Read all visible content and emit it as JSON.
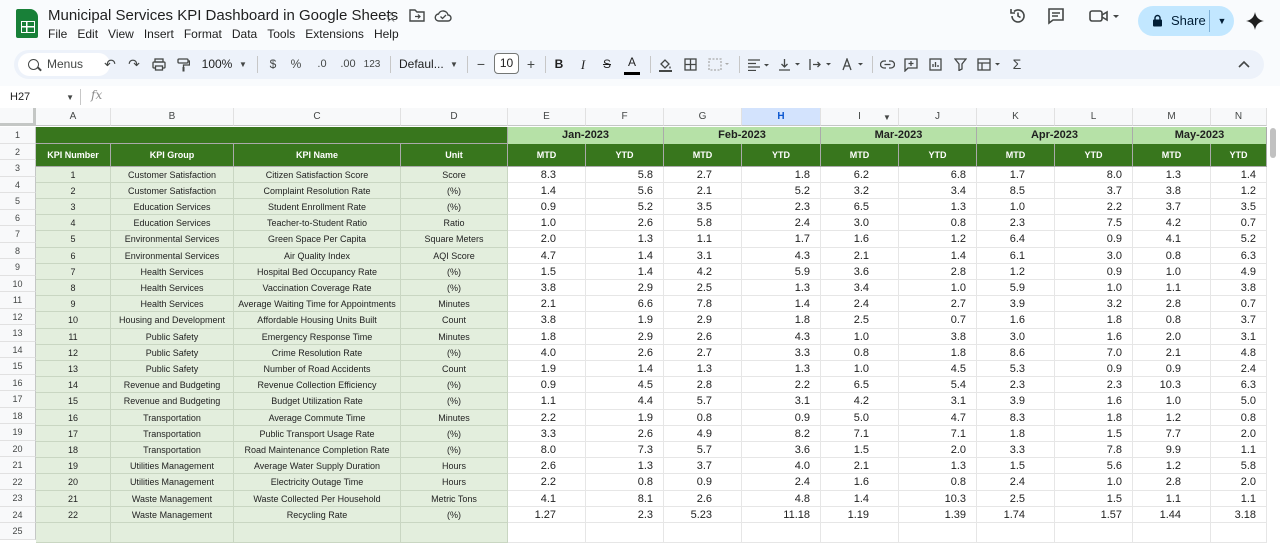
{
  "doc": {
    "title": "Municipal Services KPI Dashboard in Google Sheets"
  },
  "menu": [
    "File",
    "Edit",
    "View",
    "Insert",
    "Format",
    "Data",
    "Tools",
    "Extensions",
    "Help"
  ],
  "share": {
    "label": "Share"
  },
  "toolbar": {
    "menus": "Menus",
    "zoom": "100%",
    "currency": "$",
    "percent": "%",
    "dec_less": ".0",
    "dec_more": ".00",
    "number_fmt": "123",
    "font": "Defaul...",
    "font_size": "10"
  },
  "formula_bar": {
    "cell_ref": "H27",
    "fx": "fx"
  },
  "columns": [
    "A",
    "B",
    "C",
    "D",
    "E",
    "F",
    "G",
    "H",
    "I",
    "J",
    "K",
    "L",
    "M",
    "N"
  ],
  "selected_column": "H",
  "rows": [
    "1",
    "2",
    "3",
    "4",
    "5",
    "6",
    "7",
    "8",
    "9",
    "10",
    "11",
    "12",
    "13",
    "14",
    "15",
    "16",
    "17",
    "18",
    "19",
    "20",
    "21",
    "22",
    "23",
    "24",
    "25"
  ],
  "sheet": {
    "headers": [
      "KPI Number",
      "KPI Group",
      "KPI Name",
      "Unit"
    ],
    "months": [
      "Jan-2023",
      "Feb-2023",
      "Mar-2023",
      "Apr-2023",
      "May-2023"
    ],
    "sub": [
      "MTD",
      "YTD"
    ],
    "kpis": [
      [
        "1",
        "Customer Satisfaction",
        "Citizen Satisfaction Score",
        "Score"
      ],
      [
        "2",
        "Customer Satisfaction",
        "Complaint Resolution Rate",
        "(%)"
      ],
      [
        "3",
        "Education Services",
        "Student Enrollment Rate",
        "(%)"
      ],
      [
        "4",
        "Education Services",
        "Teacher-to-Student Ratio",
        "Ratio"
      ],
      [
        "5",
        "Environmental Services",
        "Green Space Per Capita",
        "Square Meters"
      ],
      [
        "6",
        "Environmental Services",
        "Air Quality Index",
        "AQI Score"
      ],
      [
        "7",
        "Health Services",
        "Hospital Bed Occupancy Rate",
        "(%)"
      ],
      [
        "8",
        "Health Services",
        "Vaccination Coverage Rate",
        "(%)"
      ],
      [
        "9",
        "Health Services",
        "Average Waiting Time for Appointments",
        "Minutes"
      ],
      [
        "10",
        "Housing and Development",
        "Affordable Housing Units Built",
        "Count"
      ],
      [
        "11",
        "Public Safety",
        "Emergency Response Time",
        "Minutes"
      ],
      [
        "12",
        "Public Safety",
        "Crime Resolution Rate",
        "(%)"
      ],
      [
        "13",
        "Public Safety",
        "Number of Road Accidents",
        "Count"
      ],
      [
        "14",
        "Revenue and Budgeting",
        "Revenue Collection Efficiency",
        "(%)"
      ],
      [
        "15",
        "Revenue and Budgeting",
        "Budget Utilization Rate",
        "(%)"
      ],
      [
        "16",
        "Transportation",
        "Average Commute Time",
        "Minutes"
      ],
      [
        "17",
        "Transportation",
        "Public Transport Usage Rate",
        "(%)"
      ],
      [
        "18",
        "Transportation",
        "Road Maintenance Completion Rate",
        "(%)"
      ],
      [
        "19",
        "Utilities Management",
        "Average Water Supply Duration",
        "Hours"
      ],
      [
        "20",
        "Utilities Management",
        "Electricity Outage Time",
        "Hours"
      ],
      [
        "21",
        "Waste Management",
        "Waste Collected Per Household",
        "Metric Tons"
      ],
      [
        "22",
        "Waste Management",
        "Recycling Rate",
        "(%)"
      ]
    ],
    "values": [
      [
        "8.3",
        "5.8",
        "2.7",
        "1.8",
        "6.2",
        "6.8",
        "1.7",
        "8.0",
        "1.3",
        "1.4"
      ],
      [
        "1.4",
        "5.6",
        "2.1",
        "5.2",
        "3.2",
        "3.4",
        "8.5",
        "3.7",
        "3.8",
        "1.2"
      ],
      [
        "0.9",
        "5.2",
        "3.5",
        "2.3",
        "6.5",
        "1.3",
        "1.0",
        "2.2",
        "3.7",
        "3.5"
      ],
      [
        "1.0",
        "2.6",
        "5.8",
        "2.4",
        "3.0",
        "0.8",
        "2.3",
        "7.5",
        "4.2",
        "0.7"
      ],
      [
        "2.0",
        "1.3",
        "1.1",
        "1.7",
        "1.6",
        "1.2",
        "6.4",
        "0.9",
        "4.1",
        "5.2"
      ],
      [
        "4.7",
        "1.4",
        "3.1",
        "4.3",
        "2.1",
        "1.4",
        "6.1",
        "3.0",
        "0.8",
        "6.3"
      ],
      [
        "1.5",
        "1.4",
        "4.2",
        "5.9",
        "3.6",
        "2.8",
        "1.2",
        "0.9",
        "1.0",
        "4.9"
      ],
      [
        "3.8",
        "2.9",
        "2.5",
        "1.3",
        "3.4",
        "1.0",
        "5.9",
        "1.0",
        "1.1",
        "3.8"
      ],
      [
        "2.1",
        "6.6",
        "7.8",
        "1.4",
        "2.4",
        "2.7",
        "3.9",
        "3.2",
        "2.8",
        "0.7"
      ],
      [
        "3.8",
        "1.9",
        "2.9",
        "1.8",
        "2.5",
        "0.7",
        "1.6",
        "1.8",
        "0.8",
        "3.7"
      ],
      [
        "1.8",
        "2.9",
        "2.6",
        "4.3",
        "1.0",
        "3.8",
        "3.0",
        "1.6",
        "2.0",
        "3.1"
      ],
      [
        "4.0",
        "2.6",
        "2.7",
        "3.3",
        "0.8",
        "1.8",
        "8.6",
        "7.0",
        "2.1",
        "4.8"
      ],
      [
        "1.9",
        "1.4",
        "1.3",
        "1.3",
        "1.0",
        "4.5",
        "5.3",
        "0.9",
        "0.9",
        "2.4"
      ],
      [
        "0.9",
        "4.5",
        "2.8",
        "2.2",
        "6.5",
        "5.4",
        "2.3",
        "2.3",
        "10.3",
        "6.3"
      ],
      [
        "1.1",
        "4.4",
        "5.7",
        "3.1",
        "4.2",
        "3.1",
        "3.9",
        "1.6",
        "1.0",
        "5.0"
      ],
      [
        "2.2",
        "1.9",
        "0.8",
        "0.9",
        "5.0",
        "4.7",
        "8.3",
        "1.8",
        "1.2",
        "0.8"
      ],
      [
        "3.3",
        "2.6",
        "4.9",
        "8.2",
        "7.1",
        "7.1",
        "1.8",
        "1.5",
        "7.7",
        "2.0"
      ],
      [
        "8.0",
        "7.3",
        "5.7",
        "3.6",
        "1.5",
        "2.0",
        "3.3",
        "7.8",
        "9.9",
        "1.1"
      ],
      [
        "2.6",
        "1.3",
        "3.7",
        "4.0",
        "2.1",
        "1.3",
        "1.5",
        "5.6",
        "1.2",
        "5.8"
      ],
      [
        "2.2",
        "0.8",
        "0.9",
        "2.4",
        "1.6",
        "0.8",
        "2.4",
        "1.0",
        "2.8",
        "2.0"
      ],
      [
        "4.1",
        "8.1",
        "2.6",
        "4.8",
        "1.4",
        "10.3",
        "2.5",
        "1.5",
        "1.1",
        "1.1"
      ],
      [
        "1.27",
        "2.3",
        "5.23",
        "11.18",
        "1.19",
        "1.39",
        "1.74",
        "1.57",
        "1.44",
        "3.18"
      ]
    ]
  }
}
